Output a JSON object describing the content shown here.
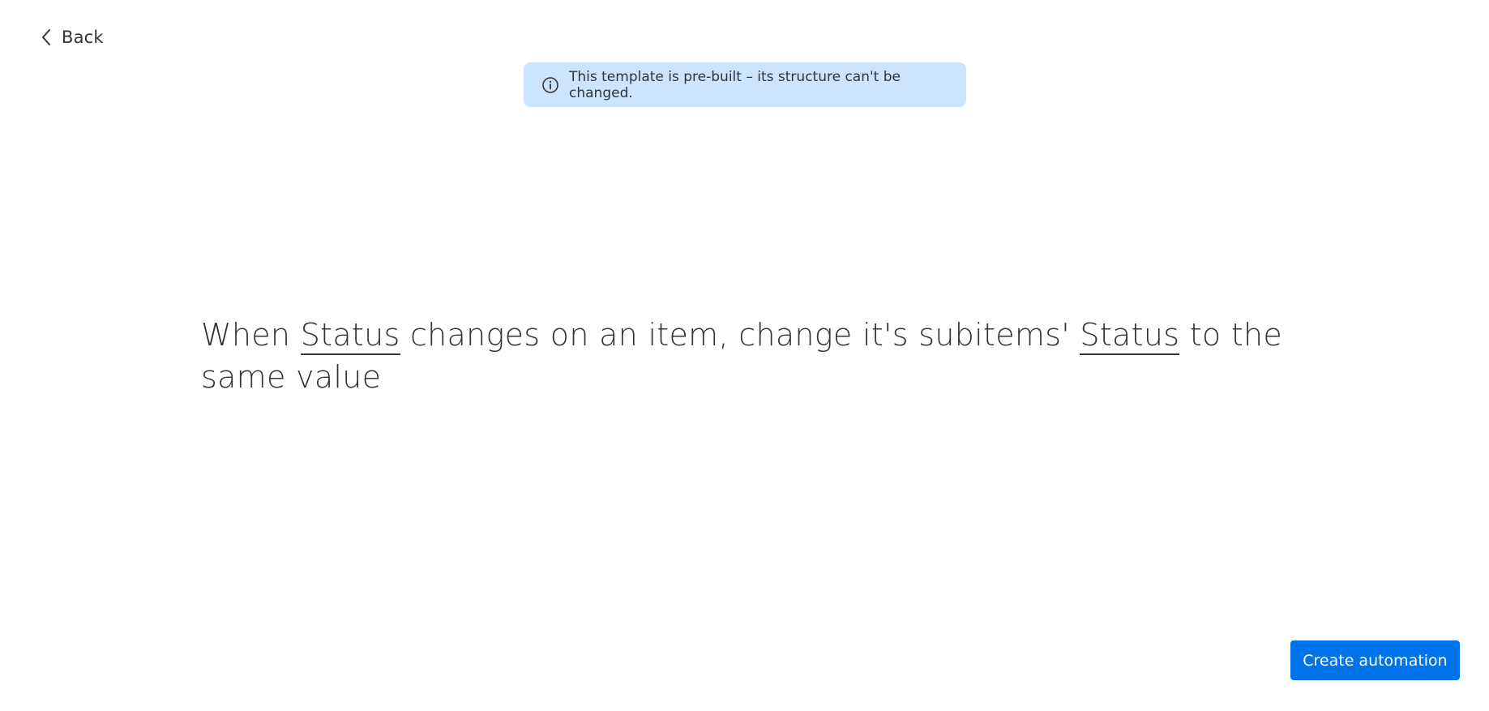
{
  "nav": {
    "back_label": "Back",
    "back_icon": "chevron-left-icon"
  },
  "banner": {
    "icon": "info-icon",
    "text": "This template is pre-built – its structure can't be changed.",
    "background_color": "#cce5ff"
  },
  "recipe": {
    "part1": "When ",
    "token1": "Status",
    "part2": " changes on an item, change it's subitems' ",
    "token2": "Status",
    "part3": " to the same value"
  },
  "actions": {
    "create_label": "Create automation",
    "accent_color": "#0073ea"
  }
}
